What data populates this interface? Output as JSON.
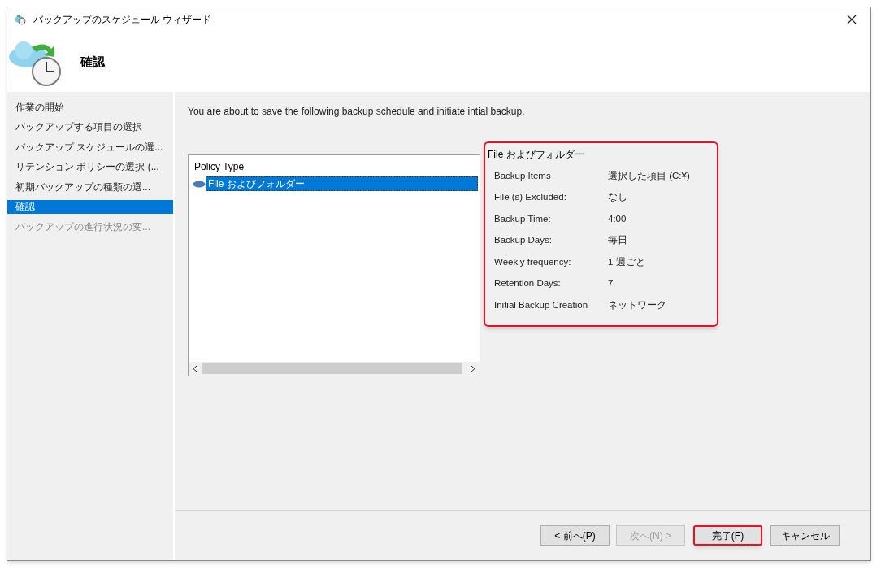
{
  "window": {
    "title": "バックアップのスケジュール ウィザード"
  },
  "header": {
    "title": "確認"
  },
  "steps": [
    {
      "label": "作業の開始",
      "selected": false,
      "disabled": false
    },
    {
      "label": "バックアップする項目の選択",
      "selected": false,
      "disabled": false
    },
    {
      "label": "バックアップ スケジュールの選...",
      "selected": false,
      "disabled": false
    },
    {
      "label": "リテンション ポリシーの選択 (...",
      "selected": false,
      "disabled": false
    },
    {
      "label": "初期バックアップの種類の選...",
      "selected": false,
      "disabled": false
    },
    {
      "label": "確認",
      "selected": true,
      "disabled": false
    },
    {
      "label": "バックアップの進行状況の変...",
      "selected": false,
      "disabled": true
    }
  ],
  "intro": "You are about to save the following backup schedule and initiate intial backup.",
  "policy_list": {
    "column_header": "Policy Type",
    "items": [
      {
        "label": "File およびフォルダー",
        "selected": true
      }
    ]
  },
  "summary": {
    "title": "File およびフォルダー",
    "rows": [
      {
        "label": "Backup Items",
        "value": "選択した項目 (C:¥)"
      },
      {
        "label": "File (s) Excluded:",
        "value": "なし"
      },
      {
        "label": "Backup Time:",
        "value": "4:00"
      },
      {
        "label": "Backup Days:",
        "value": "毎日"
      },
      {
        "label": "Weekly frequency:",
        "value": "1 週ごと"
      },
      {
        "label": "Retention Days:",
        "value": "7"
      },
      {
        "label": "Initial Backup Creation",
        "value": "ネットワーク"
      }
    ]
  },
  "buttons": [
    {
      "label": "< 前へ(P)",
      "disabled": false,
      "focused": false
    },
    {
      "label": "次へ(N) >",
      "disabled": true,
      "focused": false
    },
    {
      "label": "完了(F)",
      "disabled": false,
      "focused": true
    },
    {
      "label": "キャンセル",
      "disabled": false,
      "focused": false
    }
  ]
}
